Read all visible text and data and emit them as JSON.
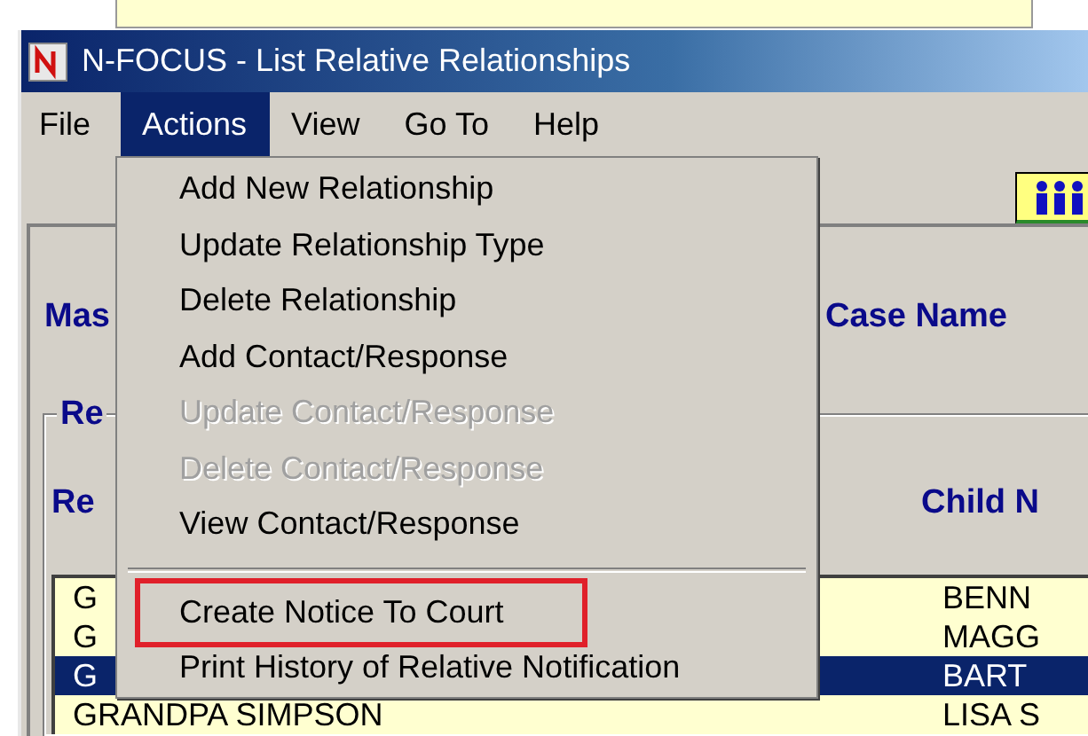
{
  "window": {
    "title": "N-FOCUS - List Relative Relationships"
  },
  "menu_bar": [
    {
      "label": "File",
      "selected": false
    },
    {
      "label": "Actions",
      "selected": true
    },
    {
      "label": "View",
      "selected": false
    },
    {
      "label": "Go To",
      "selected": false
    },
    {
      "label": "Help",
      "selected": false
    }
  ],
  "actions_menu": [
    {
      "kind": "item",
      "label": "Add New Relationship",
      "disabled": false,
      "highlighted": false
    },
    {
      "kind": "item",
      "label": "Update Relationship Type",
      "disabled": false,
      "highlighted": false
    },
    {
      "kind": "item",
      "label": "Delete Relationship",
      "disabled": false,
      "highlighted": false
    },
    {
      "kind": "item",
      "label": "Add Contact/Response",
      "disabled": false,
      "highlighted": false
    },
    {
      "kind": "item",
      "label": "Update Contact/Response",
      "disabled": true,
      "highlighted": false
    },
    {
      "kind": "item",
      "label": "Delete Contact/Response",
      "disabled": true,
      "highlighted": false
    },
    {
      "kind": "item",
      "label": "View Contact/Response",
      "disabled": false,
      "highlighted": false
    },
    {
      "kind": "separator"
    },
    {
      "kind": "item",
      "label": "Create Notice To Court",
      "disabled": false,
      "highlighted": true
    },
    {
      "kind": "item",
      "label": "Print History of Relative Notification",
      "disabled": false,
      "highlighted": false
    }
  ],
  "header": {
    "label_1": "Mas",
    "label_2": "Case Name"
  },
  "group": {
    "title": "Re",
    "columns": [
      "Re",
      "Child N"
    ],
    "rows": [
      {
        "relative": "G",
        "child": "BENN",
        "selected": false
      },
      {
        "relative": "G",
        "child": "MAGG",
        "selected": false
      },
      {
        "relative": "G",
        "child": "BART",
        "selected": true
      },
      {
        "relative": "GRANDPA SIMPSON",
        "child": "LISA S",
        "selected": false
      }
    ]
  }
}
